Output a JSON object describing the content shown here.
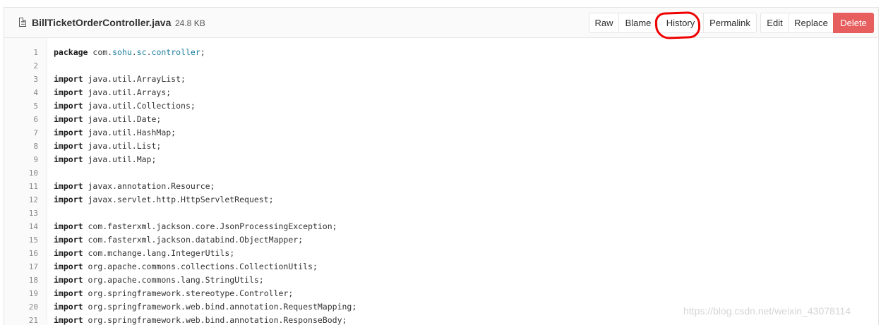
{
  "file": {
    "name": "BillTicketOrderController.java",
    "size": "24.8 KB",
    "icon": "file-icon"
  },
  "actions": {
    "raw": "Raw",
    "blame": "Blame",
    "history": "History",
    "permalink": "Permalink",
    "edit": "Edit",
    "replace": "Replace",
    "delete": "Delete"
  },
  "colors": {
    "delete_bg": "#e75e5e",
    "annotation": "#f00000",
    "identifier_highlight": "#1c7d9e"
  },
  "code": {
    "lines": [
      {
        "n": "1",
        "kw": "package",
        "rest": " com.",
        "hl1": "sohu",
        "mid": ".",
        "hl2": "sc",
        "mid2": ".",
        "hl3": "controller",
        "end": ";"
      },
      {
        "n": "2",
        "kw": "",
        "rest": ""
      },
      {
        "n": "3",
        "kw": "import",
        "rest": " java.util.ArrayList;"
      },
      {
        "n": "4",
        "kw": "import",
        "rest": " java.util.Arrays;"
      },
      {
        "n": "5",
        "kw": "import",
        "rest": " java.util.Collections;"
      },
      {
        "n": "6",
        "kw": "import",
        "rest": " java.util.Date;"
      },
      {
        "n": "7",
        "kw": "import",
        "rest": " java.util.HashMap;"
      },
      {
        "n": "8",
        "kw": "import",
        "rest": " java.util.List;"
      },
      {
        "n": "9",
        "kw": "import",
        "rest": " java.util.Map;"
      },
      {
        "n": "10",
        "kw": "",
        "rest": ""
      },
      {
        "n": "11",
        "kw": "import",
        "rest": " javax.annotation.Resource;"
      },
      {
        "n": "12",
        "kw": "import",
        "rest": " javax.servlet.http.HttpServletRequest;"
      },
      {
        "n": "13",
        "kw": "",
        "rest": ""
      },
      {
        "n": "14",
        "kw": "import",
        "rest": " com.fasterxml.jackson.core.JsonProcessingException;"
      },
      {
        "n": "15",
        "kw": "import",
        "rest": " com.fasterxml.jackson.databind.ObjectMapper;"
      },
      {
        "n": "16",
        "kw": "import",
        "rest": " com.mchange.lang.IntegerUtils;"
      },
      {
        "n": "17",
        "kw": "import",
        "rest": " org.apache.commons.collections.CollectionUtils;"
      },
      {
        "n": "18",
        "kw": "import",
        "rest": " org.apache.commons.lang.StringUtils;"
      },
      {
        "n": "19",
        "kw": "import",
        "rest": " org.springframework.stereotype.Controller;"
      },
      {
        "n": "20",
        "kw": "import",
        "rest": " org.springframework.web.bind.annotation.RequestMapping;"
      },
      {
        "n": "21",
        "kw": "import",
        "rest": " org.springframework.web.bind.annotation.ResponseBody;"
      }
    ]
  },
  "watermark": "https://blog.csdn.net/weixin_43078114"
}
